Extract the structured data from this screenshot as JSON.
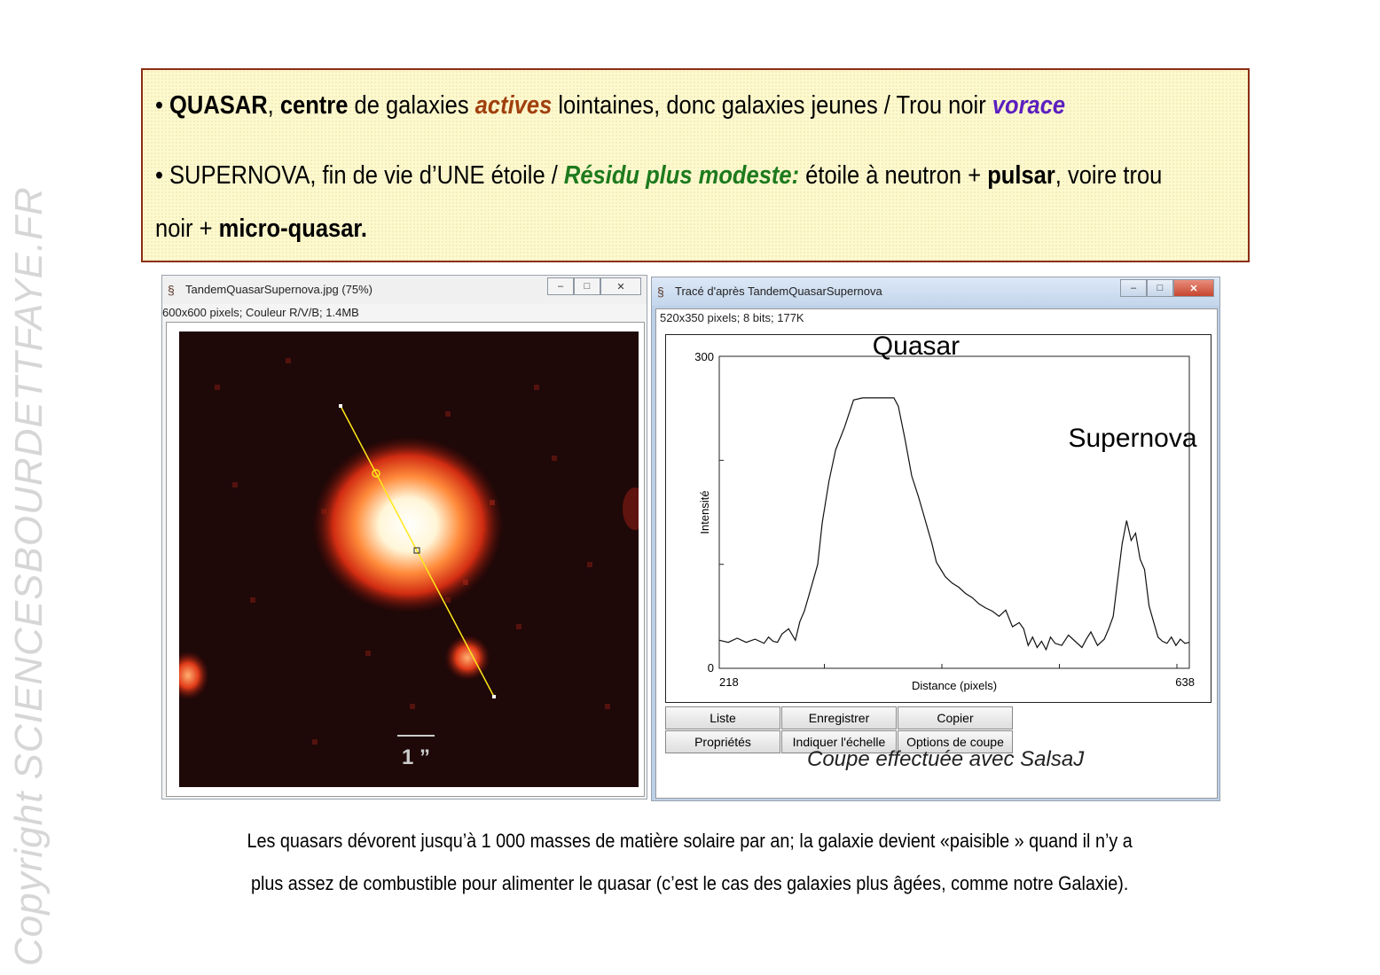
{
  "watermark": "Copyright SCIENCESBOURDETTFAYE.FR",
  "note": {
    "l1": {
      "b1": "QUASAR",
      "s1": ", ",
      "b2": "centre",
      "s2": " de galaxies ",
      "actives": "actives",
      "s3": " lointaines, donc galaxies jeunes / Trou noir ",
      "vorace": "vorace"
    },
    "l2": {
      "s1": "• SUPERNOVA, fin de vie d’UNE étoile / ",
      "residu": "Résidu plus modeste:",
      "s2": " étoile à neutron + ",
      "pulsar": "pulsar",
      "s3": ", voire trou"
    },
    "l3": {
      "s1": "noir + ",
      "mq": "micro-quasar."
    }
  },
  "image_window": {
    "title": "TandemQuasarSupernova.jpg (75%)",
    "info": "600x600 pixels; Couleur R/V/B; 1.4MB",
    "scale_label": "1 ”"
  },
  "plot_window": {
    "title": "Tracé d'après TandemQuasarSupernova",
    "info": "520x350 pixels; 8 bits; 177K",
    "buttons_row1": [
      "Liste",
      "Enregistrer",
      "Copier"
    ],
    "buttons_row2": [
      "Propriétés",
      "Indiquer l'échelle",
      "Options de coupe"
    ],
    "footer": "Coupe effectuée avec SalsaJ"
  },
  "controls": {
    "minimize": "–",
    "maximize": "□",
    "close": "✕"
  },
  "chart_data": {
    "type": "line",
    "xlabel": "Distance (pixels)",
    "ylabel": "Intensité",
    "xlim": [
      218,
      638
    ],
    "ylim": [
      0,
      300
    ],
    "x_tick_labels": [
      "218",
      "638"
    ],
    "y_tick_labels": [
      "300",
      "0"
    ],
    "annotations": [
      "Quasar",
      "Supernova"
    ],
    "series": [
      {
        "x": [
          218,
          226,
          234,
          242,
          250,
          258,
          262,
          266,
          270,
          274,
          280,
          286,
          290,
          294,
          298,
          302,
          306,
          310,
          316,
          322,
          330,
          338,
          346,
          354,
          362,
          366,
          370,
          374,
          378,
          384,
          390,
          396,
          400,
          404,
          408,
          412,
          416,
          420,
          426,
          432,
          438,
          444,
          450,
          456,
          462,
          468,
          474,
          480,
          486,
          490,
          494,
          498,
          502,
          506,
          510,
          514,
          518,
          524,
          530,
          536,
          542,
          546,
          550,
          556,
          562,
          566,
          570,
          574,
          578,
          582,
          586,
          590,
          594,
          598,
          602,
          606,
          610,
          614,
          618,
          622,
          626,
          630,
          634,
          638
        ],
        "y": [
          27,
          25,
          29,
          25,
          28,
          24,
          30,
          26,
          25,
          33,
          38,
          27,
          45,
          55,
          70,
          85,
          100,
          140,
          180,
          210,
          232,
          258,
          260,
          260,
          260,
          260,
          260,
          260,
          252,
          220,
          185,
          165,
          150,
          135,
          120,
          102,
          95,
          88,
          82,
          78,
          72,
          68,
          62,
          58,
          55,
          50,
          56,
          40,
          44,
          38,
          22,
          30,
          20,
          26,
          18,
          30,
          24,
          22,
          32,
          26,
          20,
          28,
          35,
          22,
          28,
          38,
          50,
          85,
          120,
          142,
          123,
          130,
          105,
          95,
          60,
          45,
          30,
          26,
          24,
          30,
          22,
          28,
          24,
          25
        ]
      }
    ]
  }
}
